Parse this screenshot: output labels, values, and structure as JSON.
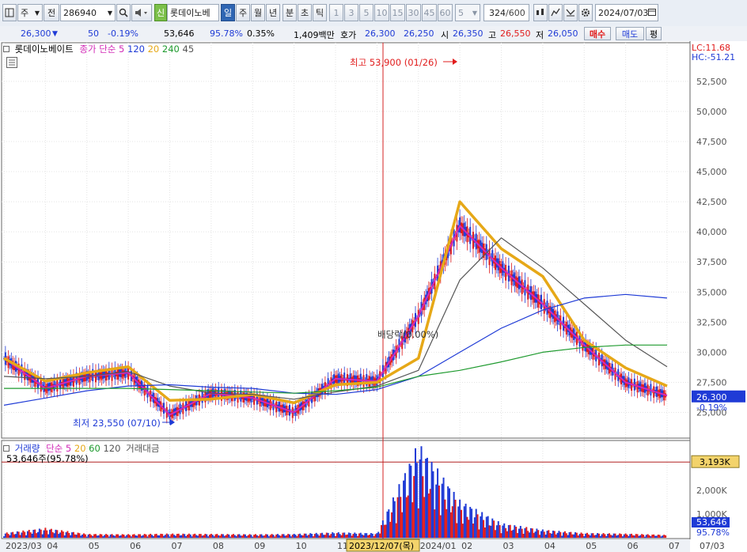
{
  "toolbar": {
    "market_type": "주",
    "side_label": "전",
    "code": "286940",
    "credit_label": "신",
    "stock_name": "롯데이노베",
    "periods": [
      "일",
      "주",
      "월",
      "년",
      "분",
      "초",
      "틱"
    ],
    "selected_period": "일",
    "intervals": [
      "1",
      "3",
      "5",
      "10",
      "15",
      "30",
      "45",
      "60"
    ],
    "interval_select": "5",
    "count": "324",
    "count_total": "/600",
    "date": "2024/07/03"
  },
  "quote": {
    "price": "26,300",
    "change": "50",
    "change_pct": "-0.19%",
    "volume": "53,646",
    "volume_ratio": "95.78%",
    "turnover": "0.35%",
    "amount": "1,409백만",
    "bid_ask_label": "호가",
    "ask": "26,300",
    "bid": "26,250",
    "open_label": "시",
    "open": "26,350",
    "high_label": "고",
    "high": "26,550",
    "low_label": "저",
    "low": "26,050",
    "buy_button": "매수",
    "sell_button": "매도",
    "eval_button": "평"
  },
  "price_legend": {
    "name": "롯데이노베이트",
    "ma_label": "종가 단순",
    "ma": [
      {
        "label": "5",
        "color": "#d22ab7"
      },
      {
        "label": "120",
        "color": "#1f3bd6"
      },
      {
        "label": "20",
        "color": "#e6a817"
      },
      {
        "label": "240",
        "color": "#1e9a2e"
      },
      {
        "label": "45",
        "color": "#555555"
      }
    ]
  },
  "volume_legend": {
    "name": "거래량",
    "ma_label": "단순",
    "ma": [
      {
        "label": "5",
        "color": "#d22ab7"
      },
      {
        "label": "20",
        "color": "#e6a817"
      },
      {
        "label": "60",
        "color": "#1e9a2e"
      },
      {
        "label": "120",
        "color": "#555555"
      }
    ],
    "amount_label": "거래대금",
    "current": "53,646주(95.78%)"
  },
  "corner": {
    "lc": "LC:11.68",
    "hc": "HC:-51.21"
  },
  "current_tag": {
    "price": "26,300",
    "pct": "-0.19%"
  },
  "volume_tags": {
    "ref": "3,193K",
    "current": "53,646",
    "pct": "95.78%"
  },
  "annotations": {
    "high": "최고 53,900 (01/26)",
    "low": "최저 23,550 (07/10)",
    "dividend": "배당락(0.00%)",
    "cursor_date": "2023/12/07(목)"
  },
  "chart_data": [
    {
      "type": "line",
      "title": "롯데이노베이트",
      "ylim": [
        23000,
        54000
      ],
      "y_ticks": [
        25000,
        27500,
        30000,
        32500,
        35000,
        37500,
        40000,
        42500,
        45000,
        47500,
        50000,
        52500
      ],
      "y_tick_labels": [
        "25,000",
        "27,500",
        "30,000",
        "32,500",
        "35,000",
        "37,500",
        "40,000",
        "42,500",
        "45,000",
        "47,500",
        "50,000",
        "52,500"
      ],
      "x_ticks": [
        "2023/03",
        "04",
        "05",
        "06",
        "07",
        "08",
        "09",
        "10",
        "11",
        "12",
        "2024/01",
        "02",
        "03",
        "04",
        "05",
        "06",
        "07"
      ],
      "right_edge_label": "07/03",
      "x": [
        "2023-03",
        "2023-04",
        "2023-05",
        "2023-06",
        "2023-07",
        "2023-08",
        "2023-09",
        "2023-10",
        "2023-11",
        "2023-12",
        "2024-01",
        "2024-02",
        "2024-03",
        "2024-04",
        "2024-05",
        "2024-06",
        "2024-07"
      ],
      "series": [
        {
          "name": "5",
          "color": "#d22ab7",
          "values": [
            29500,
            27000,
            28000,
            28300,
            24800,
            26600,
            26200,
            25000,
            27800,
            27600,
            33000,
            40500,
            37000,
            34000,
            30600,
            27500,
            26400
          ]
        },
        {
          "name": "20",
          "color": "#e6a817",
          "values": [
            29500,
            27600,
            28300,
            28800,
            26000,
            26100,
            26500,
            25800,
            27300,
            27500,
            29500,
            42500,
            38600,
            36300,
            31000,
            28700,
            27200
          ]
        },
        {
          "name": "45",
          "color": "#555555",
          "values": [
            28000,
            27800,
            28000,
            28400,
            27200,
            26600,
            26500,
            26100,
            26700,
            27200,
            28500,
            36000,
            39500,
            37000,
            34000,
            31000,
            28800
          ]
        },
        {
          "name": "120",
          "color": "#1f3bd6",
          "values": [
            25600,
            26200,
            26800,
            27200,
            27300,
            27100,
            27000,
            26600,
            26500,
            26900,
            28000,
            30000,
            32000,
            33500,
            34500,
            34800,
            34500
          ]
        },
        {
          "name": "240",
          "color": "#1e9a2e",
          "values": [
            27000,
            27000,
            27000,
            27000,
            26900,
            26800,
            26700,
            26600,
            26800,
            27100,
            28000,
            28500,
            29200,
            30000,
            30400,
            30600,
            30600
          ]
        }
      ]
    },
    {
      "type": "bar",
      "title": "거래량",
      "y_ticks": [
        1000,
        2000
      ],
      "y_tick_labels": [
        "1,000K",
        "2,000K"
      ],
      "reference_line": 3193,
      "x": [
        "2023-03",
        "2023-04",
        "2023-05",
        "2023-06",
        "2023-07",
        "2023-08",
        "2023-09",
        "2023-10",
        "2023-11",
        "2023-12",
        "2024-01",
        "2024-02",
        "2024-03",
        "2024-04",
        "2024-05",
        "2024-06",
        "2024-07"
      ],
      "values": [
        150,
        300,
        120,
        110,
        130,
        120,
        110,
        120,
        170,
        140,
        2900,
        1150,
        450,
        250,
        150,
        130,
        90
      ]
    }
  ]
}
